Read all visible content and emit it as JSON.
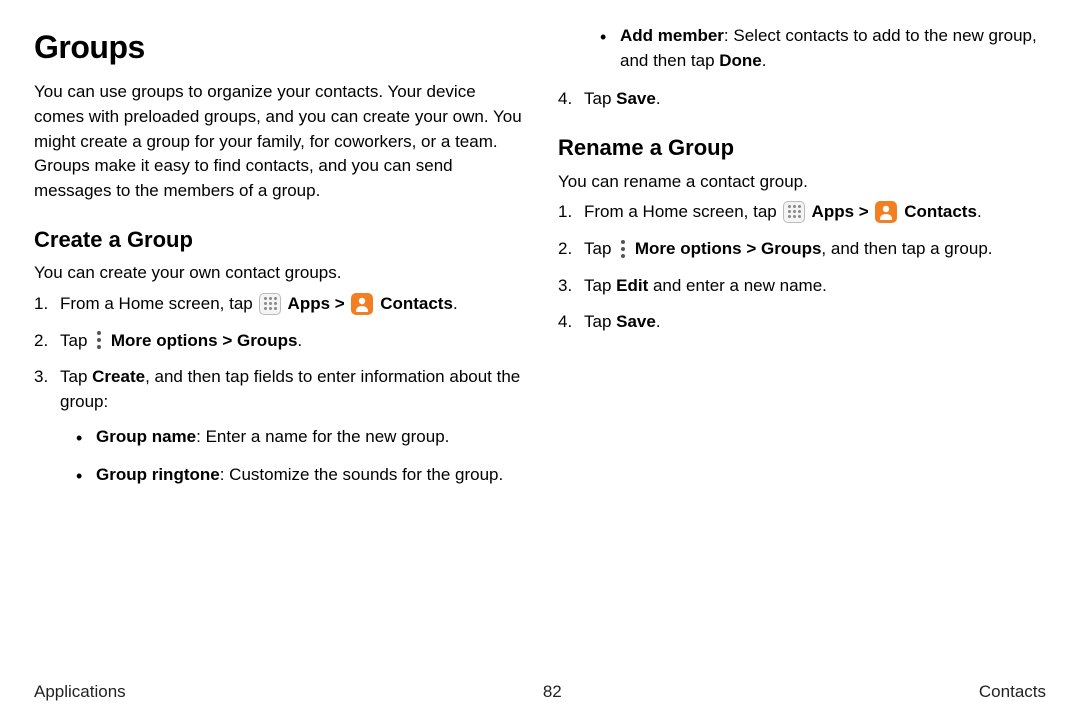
{
  "left": {
    "h1": "Groups",
    "intro": "You can use groups to organize your contacts. Your device comes with preloaded groups, and you can create your own. You might create a group for your family, for coworkers, or a team. Groups make it easy to find contacts, and you can send messages to the members of a group.",
    "h2_create": "Create a Group",
    "create_intro": "You can create your own contact groups.",
    "step1_a": "From a Home screen, tap ",
    "apps_label": " Apps ",
    "chev": ">",
    "contacts_label": " Contacts",
    "period": ".",
    "step2_a": "Tap ",
    "more_label": " More options ",
    "groups_label": " Groups",
    "step3_a": "Tap ",
    "step3_b": "Create",
    "step3_c": ", and then tap fields to enter information about the group:",
    "bullet1_a": "Group name",
    "bullet1_b": ": Enter a name for the new group.",
    "bullet2_a": "Group ringtone",
    "bullet2_b": ": Customize the sounds for the group."
  },
  "right": {
    "bullet3_a": "Add member",
    "bullet3_b": ": Select contacts to add to the new group, and then tap ",
    "bullet3_c": "Done",
    "step4_a": "Tap ",
    "step4_b": "Save",
    "h2_rename": "Rename a Group",
    "rename_intro": "You can rename a contact group.",
    "r1_a": "From a Home screen, tap ",
    "r2_a": "Tap ",
    "r2_b": " More options ",
    "r2_c": " Groups",
    "r2_d": ", and then tap a group.",
    "r3_a": "Tap ",
    "r3_b": "Edit",
    "r3_c": " and enter a new name.",
    "r4_a": "Tap ",
    "r4_b": "Save"
  },
  "footer": {
    "left": "Applications",
    "center": "82",
    "right": "Contacts"
  },
  "nums": {
    "n1": "1.",
    "n2": "2.",
    "n3": "3.",
    "n4": "4."
  }
}
